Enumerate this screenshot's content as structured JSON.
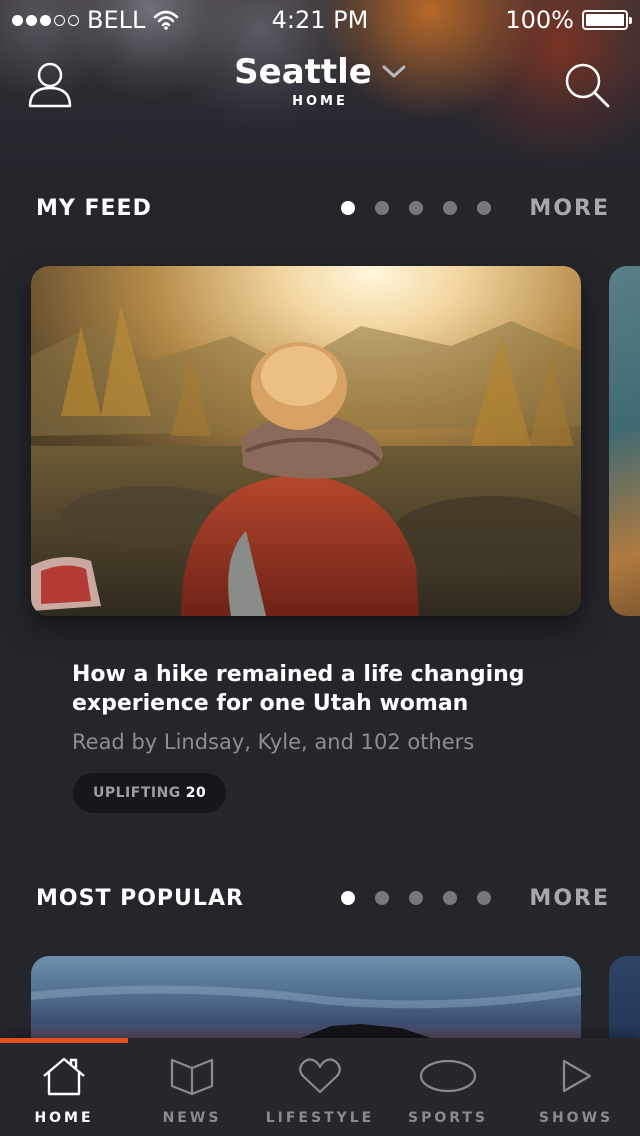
{
  "status_bar": {
    "carrier": "BELL",
    "time": "4:21 PM",
    "battery": "100%",
    "signal_bars_filled": 3,
    "signal_bars_total": 5
  },
  "header": {
    "city": "Seattle",
    "subtitle": "HOME",
    "profile_icon": "user-icon",
    "search_icon": "search-icon"
  },
  "my_feed": {
    "title": "MY FEED",
    "more_label": "MORE",
    "page_count": 5,
    "active_page": 1,
    "card": {
      "title": "How a hike remained a life changing experience for one Utah woman",
      "meta": "Read by Lindsay, Kyle, and 102 others",
      "tag_label": "UPLIFTING",
      "tag_count": "20"
    }
  },
  "most_popular": {
    "title": "MOST POPULAR",
    "more_label": "MORE",
    "page_count": 5,
    "active_page": 1
  },
  "tabs": [
    {
      "label": "HOME",
      "icon": "home-icon",
      "active": true
    },
    {
      "label": "NEWS",
      "icon": "book-icon",
      "active": false
    },
    {
      "label": "LIFESTYLE",
      "icon": "heart-icon",
      "active": false
    },
    {
      "label": "SPORTS",
      "icon": "football-icon",
      "active": false
    },
    {
      "label": "SHOWS",
      "icon": "play-icon",
      "active": false
    }
  ],
  "colors": {
    "background": "#25252c",
    "accent": "#e2501e",
    "muted_text": "#8d8d94"
  }
}
